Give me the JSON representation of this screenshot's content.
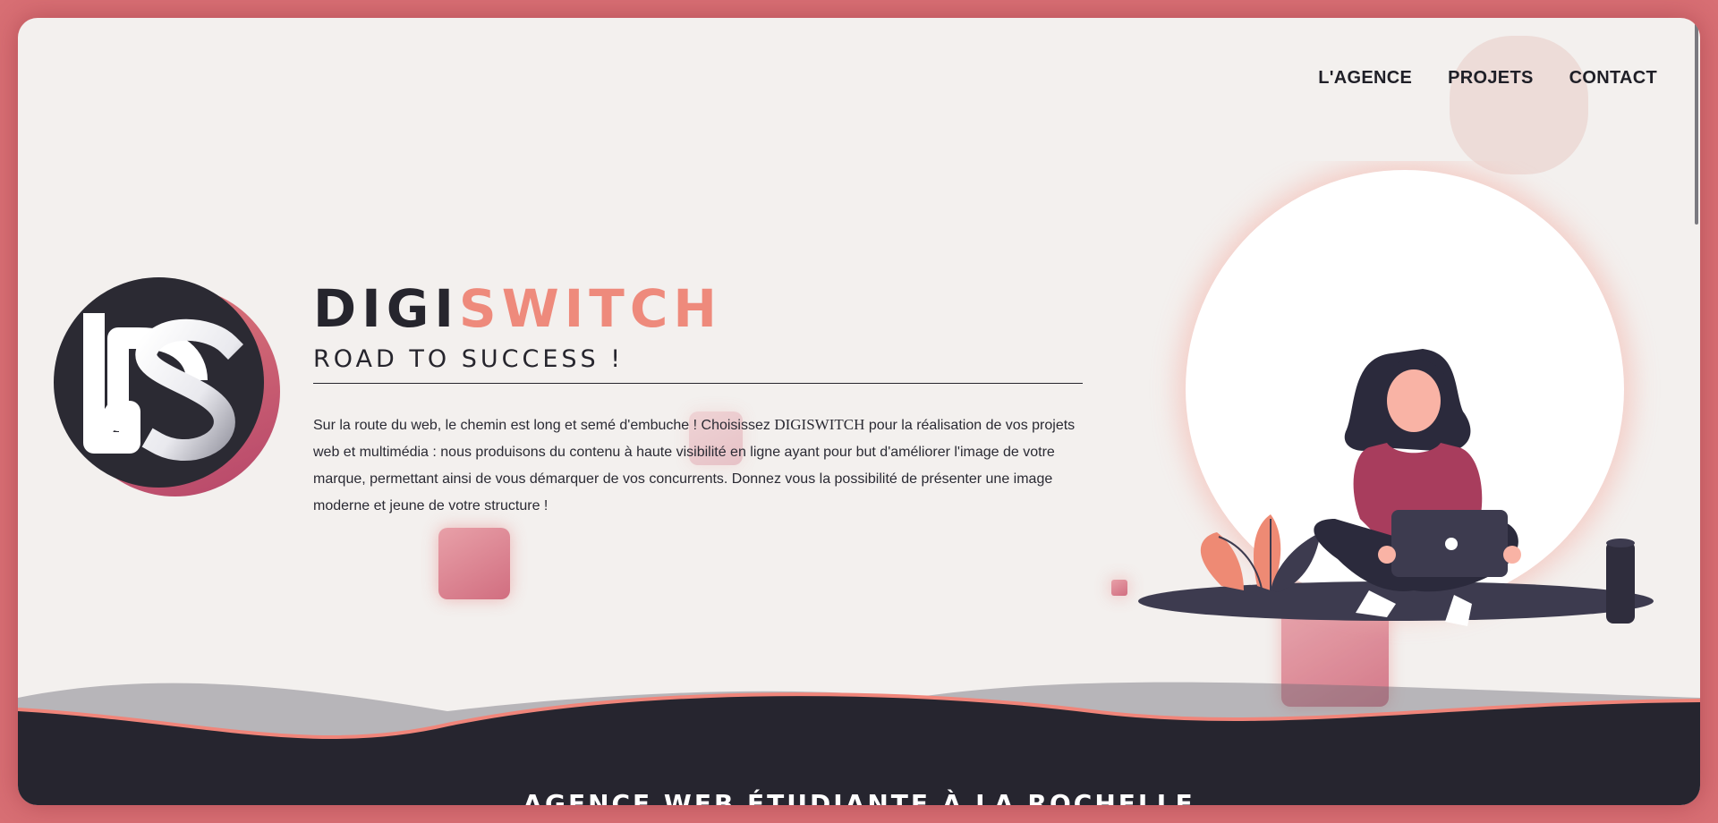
{
  "nav": {
    "items": [
      {
        "label": "L'AGENCE",
        "active": true
      },
      {
        "label": "PROJETS",
        "active": false
      },
      {
        "label": "CONTACT",
        "active": false
      }
    ]
  },
  "logo": {
    "text": "DS",
    "icon": "ds-monogram-logo"
  },
  "hero": {
    "brand_part1": "DIGI",
    "brand_part2": "SWITCH",
    "tagline": "ROAD TO SUCCESS !",
    "description_before": "Sur la route du web, le chemin est long et semé d'embuche ! Choisissez ",
    "description_brand": "DIGISWITCH",
    "description_after": " pour la réalisation de vos projets web et multimédia : nous produisons du contenu à haute visibilité en ligne ayant pour but d'améliorer l'image de votre marque, permettant ainsi de vous démarquer de vos concurrents. Donnez vous la possibilité de présenter une image moderne et jeune de votre structure !"
  },
  "illustration": {
    "icon": "woman-with-laptop-illustration"
  },
  "footer_banner": {
    "title": "AGENCE WEB ÉTUDIANTE À LA ROCHELLE"
  },
  "colors": {
    "accent": "#ee8a7c",
    "accent_dark": "#c14565",
    "dark": "#26252d",
    "frame_bg": "#f3f0ee",
    "outer_bg": "#d86f74"
  }
}
